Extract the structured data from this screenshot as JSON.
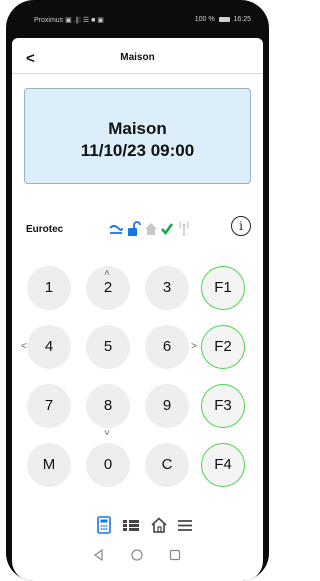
{
  "statusbar": {
    "left": "Proximus ▣ .∥∶ ☰ ■ ▣",
    "battery": "100 %",
    "time": "16:25"
  },
  "header": {
    "back_label": "<",
    "title": "Maison"
  },
  "display": {
    "line1": "Maison",
    "line2": "11/10/23  09:00"
  },
  "status": {
    "brand": "Eurotec",
    "info_label": "i"
  },
  "keypad": {
    "keys": [
      "1",
      "2",
      "3",
      "F1",
      "4",
      "5",
      "6",
      "F2",
      "7",
      "8",
      "9",
      "F3",
      "M",
      "0",
      "C",
      "F4"
    ],
    "up_chevron": "˄",
    "down_chevron": "˅",
    "left_chevron": "<",
    "right_chevron": ">"
  },
  "tabs": [
    "keypad",
    "grid",
    "home",
    "menu"
  ],
  "colors": {
    "display_bg": "#dceefa",
    "fkey_border": "#48d448",
    "accent_blue": "#1a73e8",
    "check_green": "#16a84a"
  }
}
